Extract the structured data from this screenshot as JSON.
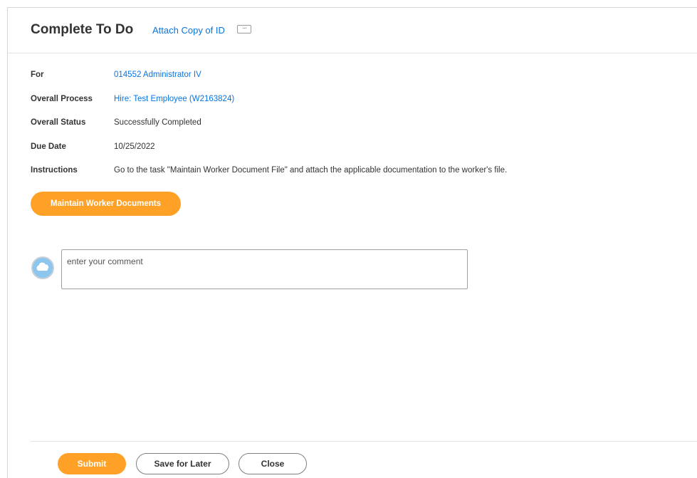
{
  "header": {
    "title": "Complete To Do",
    "subtitle": "Attach Copy of ID",
    "more_label": "···"
  },
  "fields": [
    {
      "label": "For",
      "value": "014552 Administrator IV"
    },
    {
      "label": "Overall Process",
      "value": "Hire: Test Employee (W2163824)"
    },
    {
      "label": "Overall Status",
      "value": "Successfully Completed"
    },
    {
      "label": "Due Date",
      "value": "10/25/2022"
    },
    {
      "label": "Instructions",
      "value": "Go to the task \"Maintain Worker Document File\" and attach the applicable documentation to the worker's file."
    }
  ],
  "maintain_button": "Maintain Worker Documents",
  "comment": {
    "placeholder": "enter your comment",
    "avatar_icon": "cloud-icon"
  },
  "footer": {
    "submit": "Submit",
    "save_for_later": "Save for Later",
    "close": "Close"
  },
  "colors": {
    "accent": "#ffa126",
    "link": "#0875e1"
  }
}
